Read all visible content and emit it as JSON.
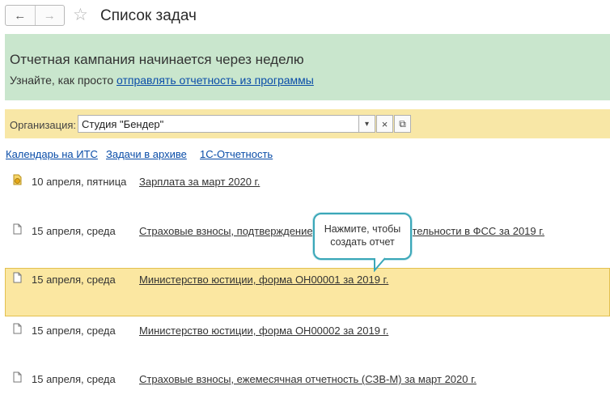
{
  "header": {
    "title": "Список задач",
    "back_icon": "←",
    "forward_icon": "→",
    "star_icon": "☆"
  },
  "banner": {
    "title": "Отчетная кампания начинается через неделю",
    "text_prefix": "Узнайте, как просто ",
    "link_text": "отправлять отчетность из программы",
    "background": "#c9e6cd"
  },
  "organization": {
    "label": "Организация:",
    "value": "Студия \"Бендер\"",
    "dropdown_icon": "▾",
    "clear_icon": "×",
    "open_icon": "⧉",
    "background": "#f8e7a6"
  },
  "links": {
    "calendar": "Календарь на ИТС",
    "archive": "Задачи в архиве",
    "reporting": "1С-Отчетность"
  },
  "tasks": [
    {
      "date": "10 апреля, пятница",
      "title": "Зарплата за март 2020 г.",
      "icon": "coin-document-icon"
    },
    {
      "date": "15 апреля, среда",
      "title": "Страховые взносы, подтверждение основного вида деятельности в ФСС за 2019 г.",
      "icon": "document-icon"
    },
    {
      "date": "15 апреля, среда",
      "title": "Министерство юстиции, форма ОН00001 за 2019 г.",
      "icon": "document-icon",
      "selected": true
    },
    {
      "date": "15 апреля, среда",
      "title": "Министерство юстиции, форма ОН00002 за 2019 г.",
      "icon": "document-icon"
    },
    {
      "date": "15 апреля, среда",
      "title": "Страховые взносы, ежемесячная отчетность (СЗВ-М) за март 2020 г.",
      "icon": "document-icon"
    }
  ],
  "callout": {
    "line1": "Нажмите, чтобы",
    "line2": "создать отчет",
    "border_color": "#3aa7b8"
  }
}
